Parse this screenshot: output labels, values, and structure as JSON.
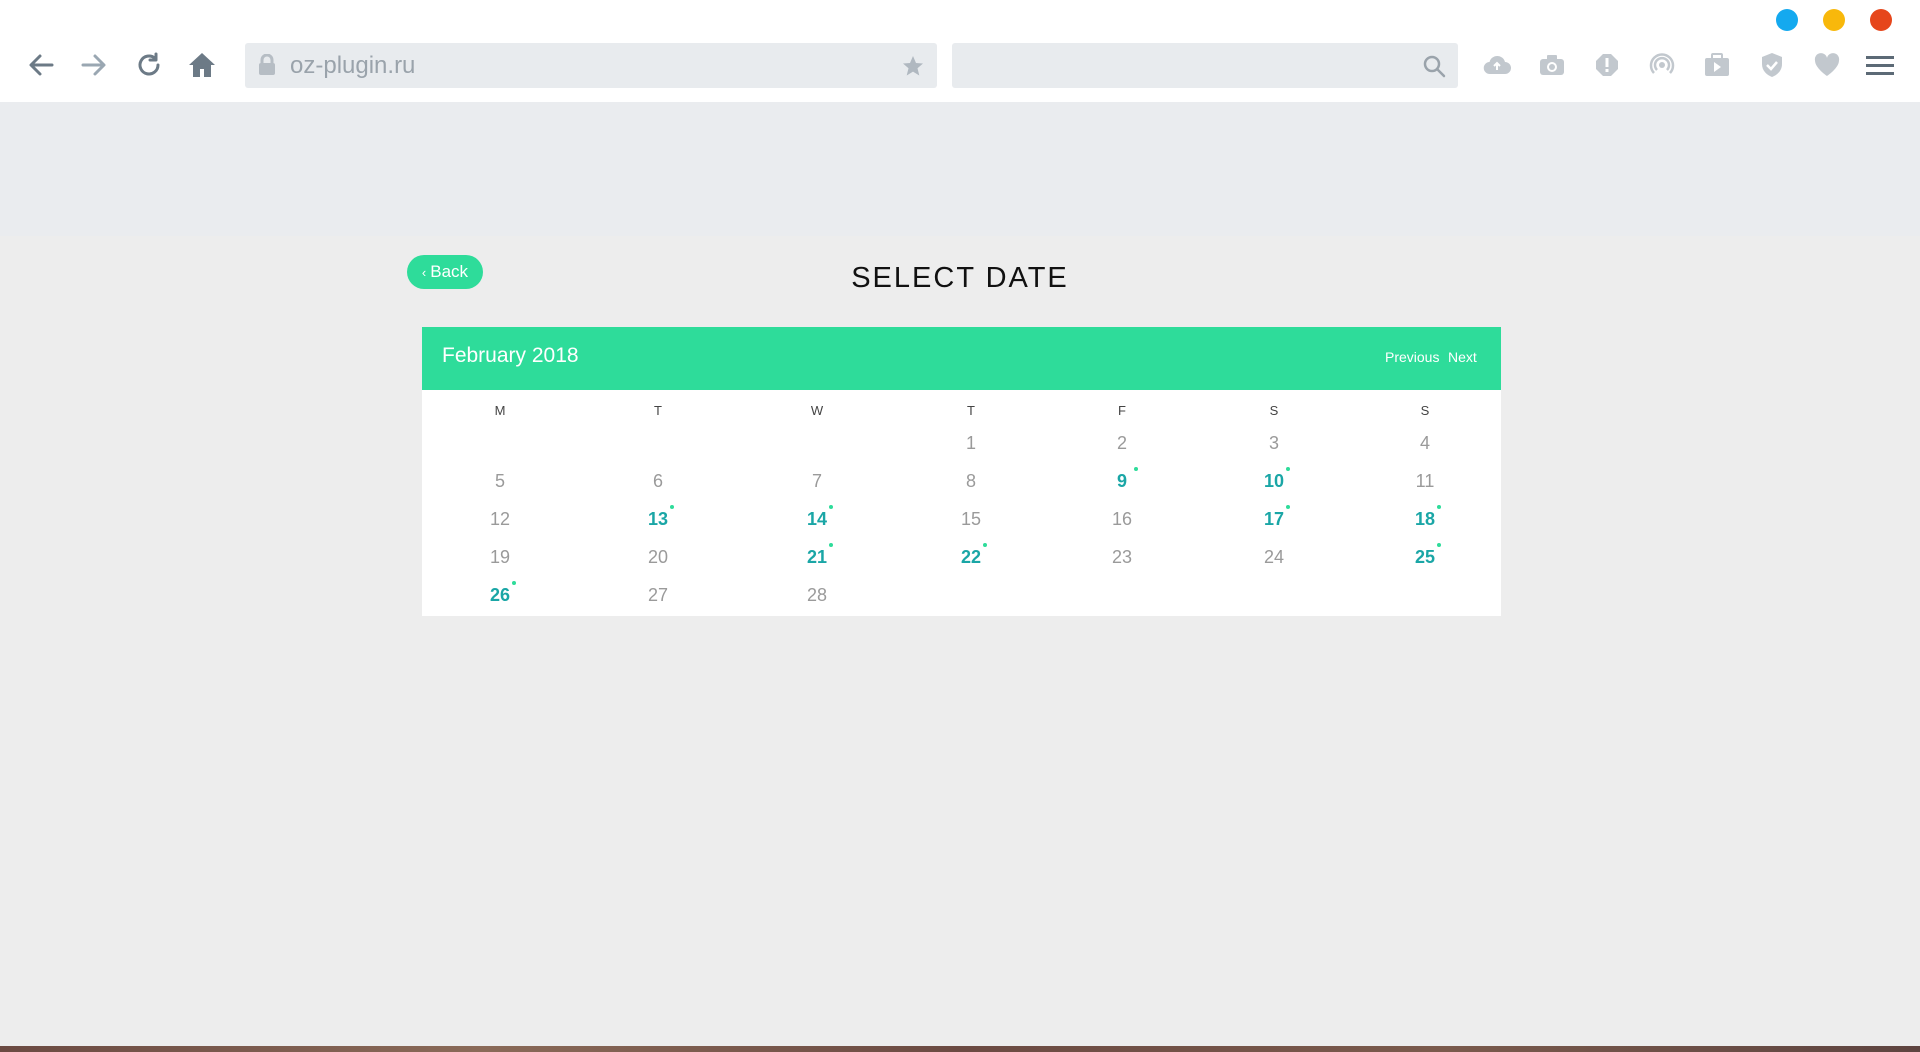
{
  "browser": {
    "url": "oz-plugin.ru",
    "search_placeholder": "",
    "window_colors": [
      "#14a9ef",
      "#f8b80b",
      "#e6461b"
    ]
  },
  "page": {
    "back_label": "Back",
    "title": "SELECT DATE"
  },
  "calendar": {
    "month_label": "February 2018",
    "previous_label": "Previous",
    "next_label": "Next",
    "weekdays": [
      "M",
      "T",
      "W",
      "T",
      "F",
      "S",
      "S"
    ],
    "available_days": [
      9,
      10,
      13,
      14,
      17,
      18,
      21,
      22,
      25,
      26
    ],
    "accent_color": "#2edc9a",
    "available_color": "#1aa6a6"
  }
}
